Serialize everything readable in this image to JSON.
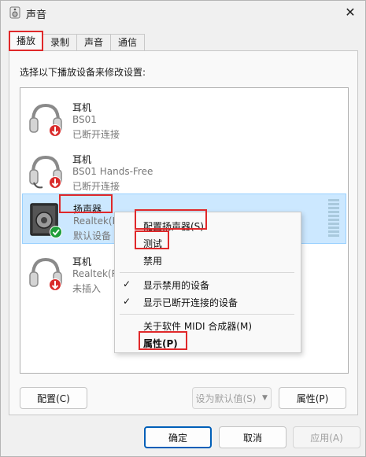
{
  "window": {
    "title": "声音",
    "icon": "speaker-icon",
    "close_glyph": "✕"
  },
  "tabs": [
    {
      "label": "播放",
      "active": true
    },
    {
      "label": "录制",
      "active": false
    },
    {
      "label": "声音",
      "active": false
    },
    {
      "label": "通信",
      "active": false
    }
  ],
  "instruction": "选择以下播放设备来修改设置:",
  "devices": [
    {
      "name": "耳机",
      "sub": "BS01",
      "status": "已断开连接",
      "badge": "disconnected",
      "icon": "headphones-icon"
    },
    {
      "name": "耳机",
      "sub": "BS01 Hands-Free",
      "status": "已断开连接",
      "badge": "disconnected",
      "icon": "headset-icon"
    },
    {
      "name": "扬声器",
      "sub": "Realtek(R",
      "status": "默认设备",
      "badge": "default",
      "icon": "speaker-device-icon",
      "selected": true
    },
    {
      "name": "耳机",
      "sub": "Realtek(R",
      "status": "未插入",
      "badge": "disconnected",
      "icon": "headphones-icon"
    }
  ],
  "context_menu": {
    "configure": "配置扬声器(S)",
    "test": "测试",
    "disable": "禁用",
    "show_disabled": "显示禁用的设备",
    "show_disconnected": "显示已断开连接的设备",
    "about_midi": "关于软件 MIDI 合成器(M)",
    "properties": "属性(P)",
    "check_glyph": "✓"
  },
  "buttons": {
    "configure": "配置(C)",
    "set_default": "设为默认值(S)",
    "properties": "属性(P)",
    "ok": "确定",
    "cancel": "取消",
    "apply": "应用(A)",
    "dropdown_glyph": "▼"
  },
  "colors": {
    "selection_bg": "#cce8ff",
    "highlight_box": "#e0282a",
    "primary_border": "#005fb8",
    "default_badge": "#1e9e3a",
    "disconnected_badge": "#d92b2b"
  }
}
